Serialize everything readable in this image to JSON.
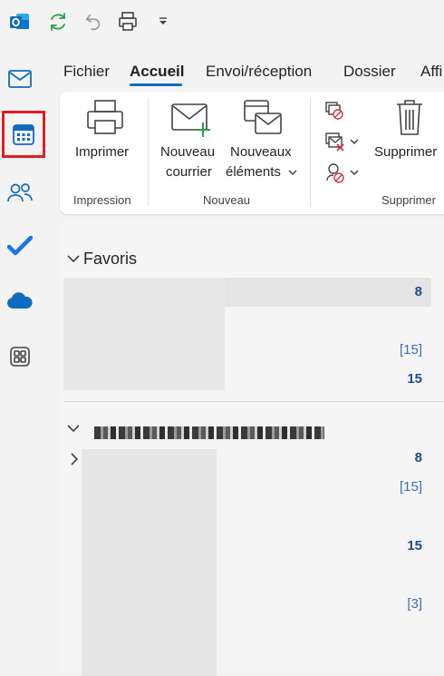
{
  "tabs": [
    {
      "label": "Fichier"
    },
    {
      "label": "Accueil"
    },
    {
      "label": "Envoi/réception"
    },
    {
      "label": "Dossier"
    },
    {
      "label": "Affi"
    }
  ],
  "ribbon": {
    "print": {
      "label": "Imprimer"
    },
    "new_mail": {
      "line1": "Nouveau",
      "line2": "courrier"
    },
    "new_items": {
      "line1": "Nouveaux",
      "line2": "éléments"
    },
    "delete": {
      "label": "Supprimer"
    },
    "groups": {
      "impression": "Impression",
      "nouveau": "Nouveau",
      "supprimer": "Supprimer"
    }
  },
  "pane": {
    "favorites": {
      "label": "Favoris",
      "counts": [
        "8",
        "[15]",
        "15"
      ]
    },
    "account": {
      "counts": [
        "8",
        "[15]",
        "15",
        "[3]"
      ]
    }
  },
  "colors": {
    "accent": "#0f6cbd",
    "highlight_box": "#e51c23",
    "count_text": "#2b579a"
  }
}
